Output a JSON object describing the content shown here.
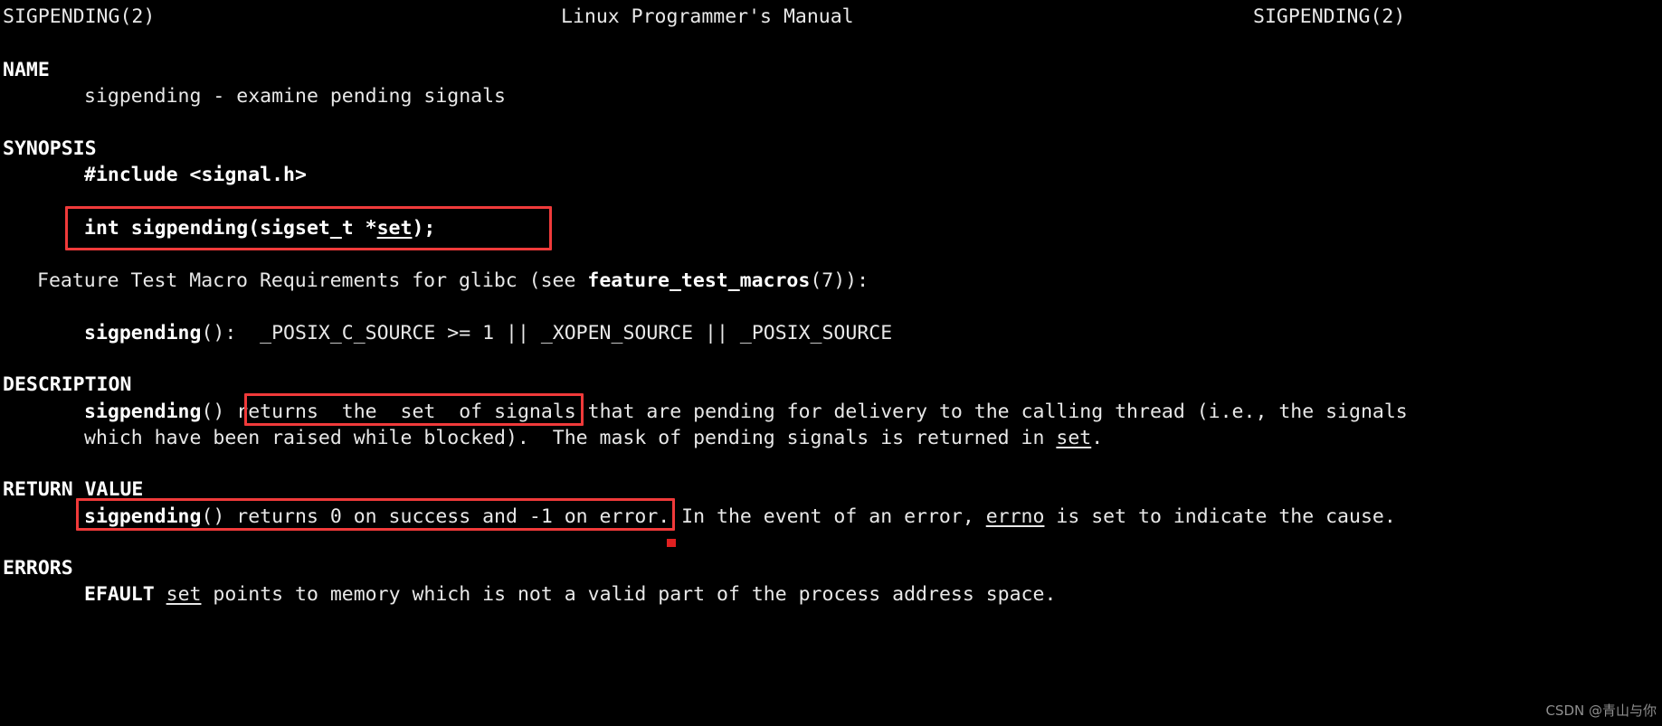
{
  "page": {
    "background_color": "#000000",
    "text_color": "#e8e8e8",
    "annotation_color": "#f03a3a"
  },
  "header": {
    "left": "SIGPENDING(2)",
    "center": "Linux Programmer's Manual",
    "right": "SIGPENDING(2)"
  },
  "sections": {
    "name": {
      "heading": "NAME",
      "body": "sigpending - examine pending signals"
    },
    "synopsis": {
      "heading": "SYNOPSIS",
      "include": "#include <signal.h>",
      "prototype_pre": "int sigpending(sigset_t *",
      "prototype_arg": "set",
      "prototype_post": ");",
      "feature_test_pre": "Feature Test Macro Requirements for glibc (see ",
      "feature_test_bold": "feature_test_macros",
      "feature_test_post": "(7)):",
      "macro_func": "sigpending",
      "macro_rest": "():  _POSIX_C_SOURCE >= 1 || _XOPEN_SOURCE || _POSIX_SOURCE"
    },
    "description": {
      "heading": "DESCRIPTION",
      "line1_func": "sigpending",
      "line1_boxed": "returns  the  set  of signals",
      "line1_rest": " that are pending for delivery to the calling thread (i.e., the signals",
      "line2_pre": "which have been raised while blocked).  The mask of pending signals is returned in ",
      "line2_underlined": "set",
      "line2_post": "."
    },
    "return_value": {
      "heading": "RETURN VALUE",
      "boxed_func": "sigpending",
      "boxed_rest": "() returns 0 on success and -1 on error.",
      "rest_pre": " In the event of an error, ",
      "rest_underlined": "errno",
      "rest_post": " is set to indicate the cause."
    },
    "errors": {
      "heading": "ERRORS",
      "code": "EFAULT",
      "arg": "set",
      "text": " points to memory which is not a valid part of the process address space."
    }
  },
  "annotations": {
    "box_synopsis_label": "highlight-synopsis-prototype",
    "box_description_label": "highlight-description-phrase",
    "box_return_label": "highlight-return-value",
    "dot_label": "red-cursor-mark"
  },
  "watermark": "CSDN @青山与你"
}
